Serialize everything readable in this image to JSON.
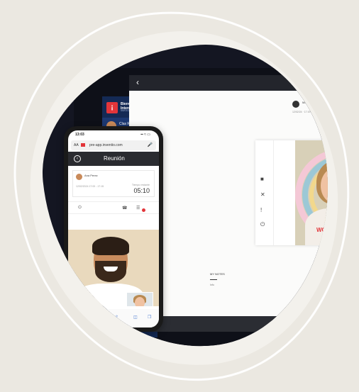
{
  "laptop": {
    "sidebar": {
      "logo_char": "¡",
      "event_title": "Bienvenido a Interclub...",
      "event_dates": "08/01/2024 - 25/09/2027",
      "user_name": "Clas Romm",
      "gear_icon": "gear-icon"
    },
    "topbar": {
      "back_icon": "chevron-left-icon",
      "title": "Me"
    },
    "host": {
      "name": "Maria Silva",
      "meta": "12/02/24 · 17:19"
    },
    "controls": [
      "camera-icon",
      "mic-off-icon",
      "info-icon",
      "power-icon"
    ],
    "shirt_text": "WOMA",
    "notes_label": "MY NOTES",
    "notes_sub": "Info"
  },
  "phone": {
    "status_time": "13:03",
    "status_signal": "▪▪ ≈ ▭",
    "url": {
      "aa": "AA",
      "address": "pre-app.inventio.com",
      "mic_icon": "mic-icon"
    },
    "header": {
      "title": "Reunión"
    },
    "card": {
      "name": "Ana Perez",
      "sub": "Info",
      "meta": "12/02/2024\n17:00 - 17:15",
      "countdown_label": "Tiempo restante",
      "countdown": "05:10"
    },
    "tools": [
      "power-icon",
      "phone-icon",
      "chat-icon"
    ]
  },
  "colors": {
    "brand_red": "#e2353a",
    "sidebar_navy": "#142a55",
    "background": "#ebe8e1"
  }
}
